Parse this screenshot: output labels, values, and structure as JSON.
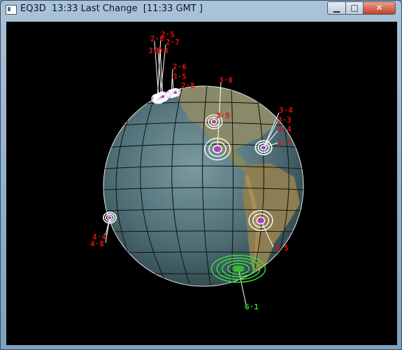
{
  "window": {
    "title": "EQ3D  13:33 Last Change  [11:33 GMT ]",
    "buttons": {
      "minimize": "▁",
      "maximize": "□",
      "close": "✕"
    }
  },
  "quakes": [
    {
      "id": "q1",
      "mag": "2·5"
    },
    {
      "id": "q2",
      "mag": "2·8"
    },
    {
      "id": "q3",
      "mag": "2·7"
    },
    {
      "id": "q4",
      "mag": "3·3"
    },
    {
      "id": "q5",
      "mag": "3·3"
    },
    {
      "id": "q6",
      "mag": "2·6"
    },
    {
      "id": "q7",
      "mag": "3·5"
    },
    {
      "id": "q8",
      "mag": "2·8"
    },
    {
      "id": "q9",
      "mag": "3·0"
    },
    {
      "id": "q10",
      "mag": "3·5"
    },
    {
      "id": "q11",
      "mag": "3·4"
    },
    {
      "id": "q12",
      "mag": "3·3"
    },
    {
      "id": "q13",
      "mag": "3·4"
    },
    {
      "id": "q14",
      "mag": "2·7"
    },
    {
      "id": "q15",
      "mag": "4·4"
    },
    {
      "id": "q16",
      "mag": "4·8"
    },
    {
      "id": "q17",
      "mag": "4·5"
    },
    {
      "id": "q18",
      "mag": "6·1"
    }
  ],
  "colors": {
    "ring": "#ffffff",
    "dot": "#b040c0",
    "label": "#e01010",
    "big_ring": "#39e639"
  }
}
